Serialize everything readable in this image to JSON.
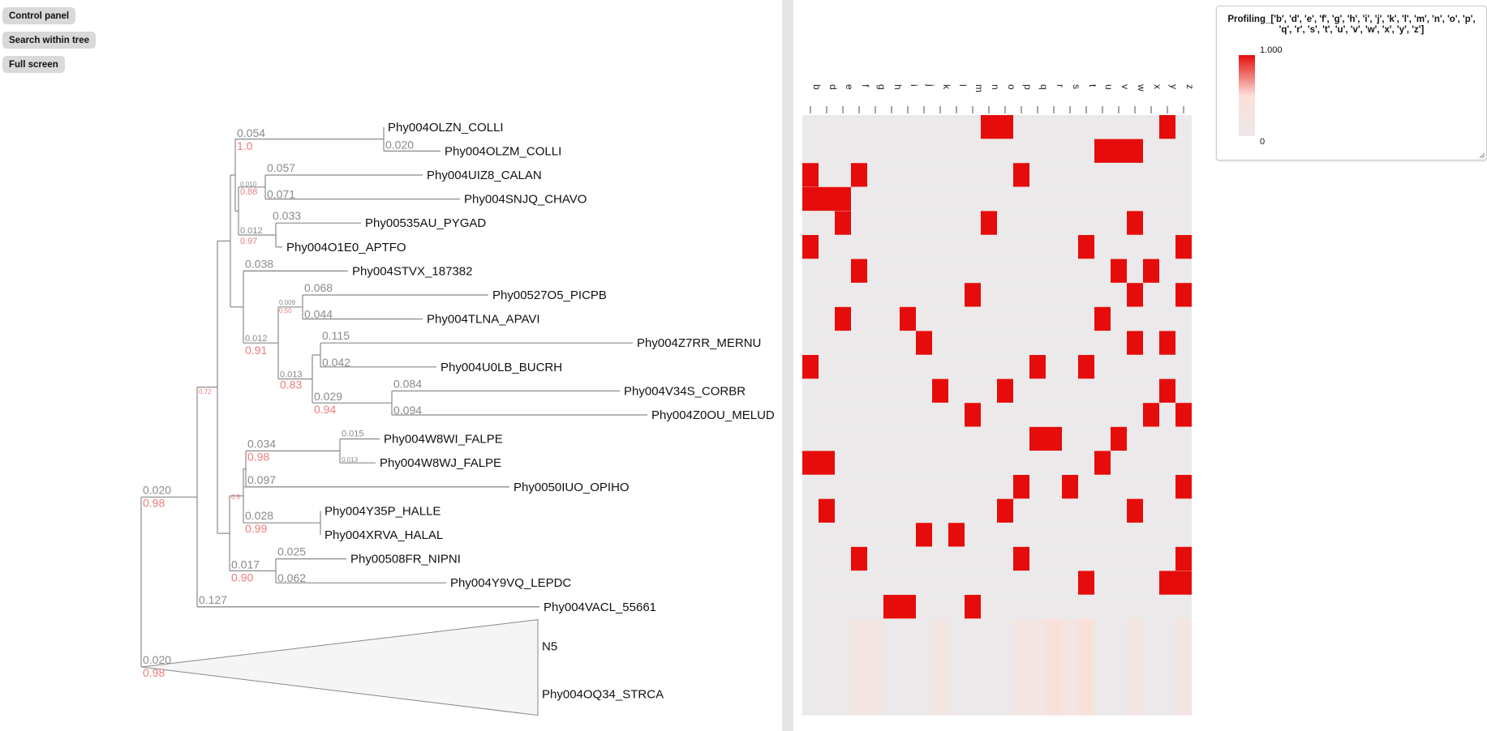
{
  "buttons": {
    "control_panel": "Control panel",
    "search_tree": "Search within tree",
    "full_screen": "Full screen"
  },
  "legend": {
    "title": "Profiling_['b', 'd', 'e', 'f', 'g', 'h', 'i', 'j', 'k', 'l', 'm', 'n', 'o', 'p', 'q', 'r', 's', 't', 'u', 'v', 'w', 'x', 'y', 'z']",
    "max_label": "1.000",
    "min_label": "0",
    "color_max": "#e60c0c",
    "color_mid": "#fbe0d8",
    "color_min": "#ebe9e9"
  },
  "tree": {
    "tips": [
      "Phy004OLZN_COLLI",
      "Phy004OLZM_COLLI",
      "Phy004UIZ8_CALAN",
      "Phy004SNJQ_CHAVO",
      "Phy00535AU_PYGAD",
      "Phy004O1E0_APTFO",
      "Phy004STVX_187382",
      "Phy00527O5_PICPB",
      "Phy004TLNA_APAVI",
      "Phy004Z7RR_MERNU",
      "Phy004U0LB_BUCRH",
      "Phy004V34S_CORBR",
      "Phy004Z0OU_MELUD",
      "Phy004W8WI_FALPE",
      "Phy004W8WJ_FALPE",
      "Phy0050IUO_OPIHO",
      "Phy004Y35P_HALLE",
      "Phy004XRVA_HALAL",
      "Phy00508FR_NIPNI",
      "Phy004Y9VQ_LEPDC",
      "Phy004VACL_55661"
    ],
    "collapsed": {
      "labels": [
        "N5",
        "Phy004OQ34_STRCA"
      ],
      "branch_length": "0.020",
      "support": "0.98"
    },
    "branch_labels": {
      "n_olzn_clade": {
        "length": "0.054",
        "support": "1.0"
      },
      "olzm": {
        "length": "0.020"
      },
      "n_uiz8_clade": {
        "length": "0.010",
        "support": "0.88"
      },
      "uiz8": {
        "length": "0.057"
      },
      "snjq": {
        "length": "0.071"
      },
      "n_pygad_clade": {
        "length": "0.012",
        "support": "0.97"
      },
      "pygad": {
        "length": "0.033"
      },
      "stvx": {
        "length": "0.038"
      },
      "n_picpb_clade": {
        "length": "0.009",
        "support": "0.50"
      },
      "picpb": {
        "length": "0.068"
      },
      "tlna": {
        "length": "0.044"
      },
      "n_mid_clade": {
        "length": "0.012",
        "support": "0.91"
      },
      "mernu": {
        "length": "0.115"
      },
      "bucrh": {
        "length": "0.042"
      },
      "n_mernu_clade": {
        "length": "0.013",
        "support": "0.83"
      },
      "n_corbr_clade": {
        "length": "0.029",
        "support": "0.94"
      },
      "corbr": {
        "length": "0.084"
      },
      "melud": {
        "length": "0.094"
      },
      "n_upper_support": {
        "support": "0.72"
      },
      "n_falpe_clade": {
        "length": "0.034",
        "support": "0.98"
      },
      "w8wi": {
        "length": "0.015"
      },
      "w8wj": {
        "length": "0.013"
      },
      "opiho": {
        "length": "0.097"
      },
      "n_lower_support": {
        "support": "0.5"
      },
      "n_hal_clade": {
        "length": "0.028",
        "support": "0.99"
      },
      "n_nipni_clade": {
        "length": "0.017",
        "support": "0.90"
      },
      "nipni": {
        "length": "0.025"
      },
      "lepdc": {
        "length": "0.062"
      },
      "vacl": {
        "length": "0.127"
      },
      "n_root_upper": {
        "length": "0.020",
        "support": "0.98"
      }
    }
  },
  "chart_data": {
    "type": "heatmap",
    "title": "Profiling_['b', 'd', 'e', 'f', 'g', 'h', 'i', 'j', 'k', 'l', 'm', 'n', 'o', 'p', 'q', 'r', 's', 't', 'u', 'v', 'w', 'x', 'y', 'z']",
    "columns": [
      "b",
      "d",
      "e",
      "f",
      "g",
      "h",
      "i",
      "j",
      "k",
      "l",
      "m",
      "n",
      "o",
      "p",
      "q",
      "r",
      "s",
      "t",
      "u",
      "v",
      "w",
      "x",
      "y",
      "z"
    ],
    "value_range": [
      0,
      1
    ],
    "rows": [
      {
        "name": "Phy004OLZN_COLLI",
        "present": [
          "n",
          "o",
          "y"
        ]
      },
      {
        "name": "Phy004OLZM_COLLI",
        "present": [
          "u",
          "v",
          "w"
        ]
      },
      {
        "name": "Phy004UIZ8_CALAN",
        "present": [
          "b",
          "f",
          "p"
        ]
      },
      {
        "name": "Phy004SNJQ_CHAVO",
        "present": [
          "b",
          "d",
          "e"
        ]
      },
      {
        "name": "Phy00535AU_PYGAD",
        "present": [
          "e",
          "n",
          "w"
        ]
      },
      {
        "name": "Phy004O1E0_APTFO",
        "present": [
          "b",
          "t",
          "z"
        ]
      },
      {
        "name": "Phy004STVX_187382",
        "present": [
          "f",
          "v",
          "x"
        ]
      },
      {
        "name": "Phy00527O5_PICPB",
        "present": [
          "m",
          "w",
          "z"
        ]
      },
      {
        "name": "Phy004TLNA_APAVI",
        "present": [
          "e",
          "i",
          "u"
        ]
      },
      {
        "name": "Phy004Z7RR_MERNU",
        "present": [
          "j",
          "w",
          "y"
        ]
      },
      {
        "name": "Phy004U0LB_BUCRH",
        "present": [
          "b",
          "q",
          "t"
        ]
      },
      {
        "name": "Phy004V34S_CORBR",
        "present": [
          "k",
          "o",
          "y"
        ]
      },
      {
        "name": "Phy004Z0OU_MELUD",
        "present": [
          "m",
          "x",
          "z"
        ]
      },
      {
        "name": "Phy004W8WI_FALPE",
        "present": [
          "q",
          "r",
          "v"
        ]
      },
      {
        "name": "Phy004W8WJ_FALPE",
        "present": [
          "b",
          "d",
          "u"
        ]
      },
      {
        "name": "Phy0050IUO_OPIHO",
        "present": [
          "p",
          "s",
          "z"
        ]
      },
      {
        "name": "Phy004Y35P_HALLE",
        "present": [
          "d",
          "o",
          "w"
        ]
      },
      {
        "name": "Phy004XRVA_HALAL",
        "present": [
          "j",
          "l"
        ]
      },
      {
        "name": "Phy00508FR_NIPNI",
        "present": [
          "f",
          "p",
          "z"
        ]
      },
      {
        "name": "Phy004Y9VQ_LEPDC",
        "present": [
          "t",
          "y",
          "z"
        ]
      },
      {
        "name": "Phy004VACL_55661",
        "present": [
          "h",
          "i",
          "m"
        ]
      }
    ],
    "collapsed_row": {
      "name": "N5",
      "values": {
        "b": 0,
        "d": 0,
        "e": 0,
        "f": 0.1,
        "g": 0.1,
        "h": 0,
        "i": 0,
        "j": 0,
        "k": 0.1,
        "l": 0,
        "m": 0,
        "n": 0,
        "o": 0,
        "p": 0.1,
        "q": 0.1,
        "r": 0.2,
        "s": 0.1,
        "t": 0.2,
        "u": 0,
        "v": 0,
        "w": 0.1,
        "x": 0,
        "y": 0,
        "z": 0.1
      }
    }
  }
}
